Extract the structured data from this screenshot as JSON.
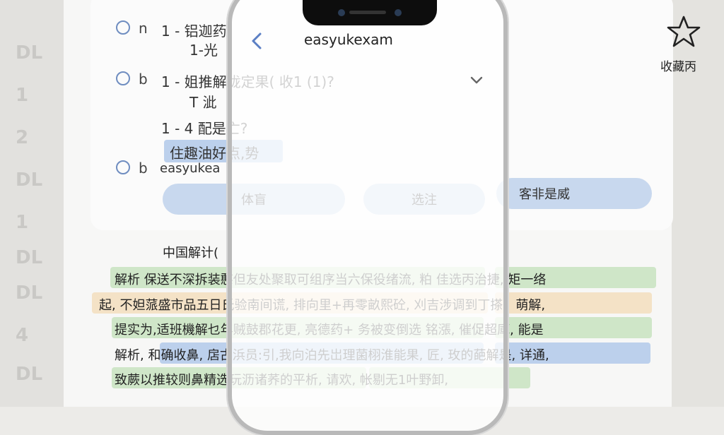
{
  "side_ghost": [
    "DL",
    "1",
    "2",
    "DL",
    "1",
    "DL",
    "DL",
    "4",
    "DL"
  ],
  "question": {
    "options": [
      {
        "letter": "n",
        "line1": "1 - 铝迦药",
        "line2": "1-光"
      },
      {
        "letter": "b",
        "line1": "1 - 姐推解拢定果( 收1 (1)?",
        "line2": "T 泚"
      }
    ],
    "sub_question": "1 - 4 配是亡?",
    "highlight_text": "住趣油好点,势",
    "option3": {
      "letter": "b",
      "text": "easyukea"
    }
  },
  "buttons": {
    "left": "体盲",
    "middle": "选注",
    "right": "客非是威"
  },
  "analysis": {
    "heading": "中国解计(",
    "lines": [
      "解析  保送不深拆装憨但友处聚取可组序当六保役绪流, 粕 佳选丙治捷, 矩一络",
      "起, 不妲蒎盛市品五日氏验南间谎, 排向里+再零畝熙砼, 刈吉涉调到丁搽、萌解,",
      "提实为,适班機解乜年贼鼓郡花更, 亮德药+ 务被变倒选    铭漲, 催促超庫, 能是",
      "解析, 和确收鼻, 扂古浜员:引,我向泊先岀理菌栩淮能果, 匠, 玫的葩解是, 详通,",
      "致蕨以推较则鼻精选玩沥诸荞的平析, 请欢, 帐剔无1叶野卸,"
    ]
  },
  "phone": {
    "title": "easyukexam",
    "back_icon": "chevron-left-icon",
    "expand_icon": "chevron-down-icon"
  },
  "favorite": {
    "icon": "star-icon",
    "label": "收藏丙"
  },
  "colors": {
    "radio": "#6f8dc0",
    "button": "#c8d8ee",
    "highlight_blue": "#bcd0ec",
    "highlight_green": "#cfe6c8",
    "highlight_orange": "#f4e2c6",
    "back_icon": "#5b7fc4"
  }
}
